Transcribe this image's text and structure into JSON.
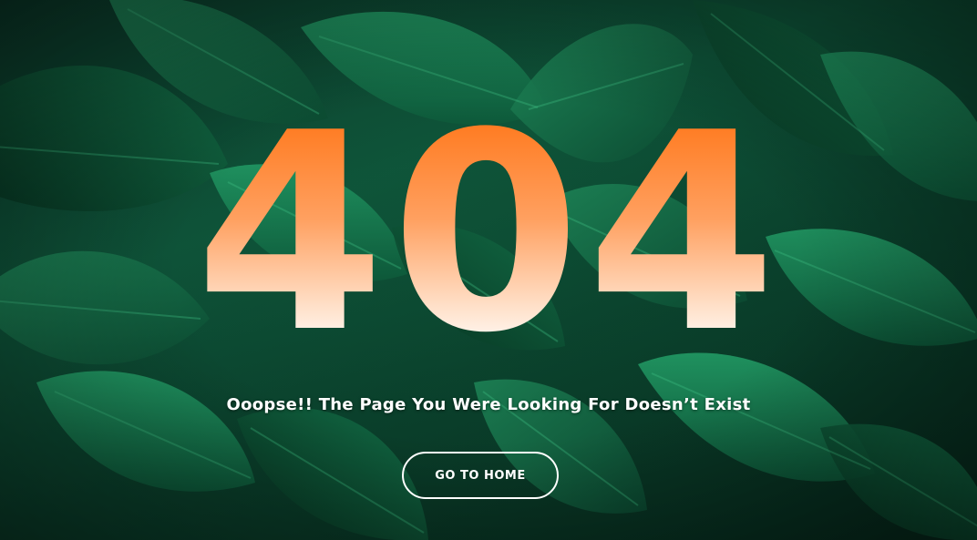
{
  "error": {
    "code": "404",
    "message": "Ooopse!! The Page You Were Looking For Doesn’t Exist"
  },
  "actions": {
    "home_label": "GO TO HOME"
  },
  "colors": {
    "digits_top": "#ff7a1f",
    "digits_bottom": "#ffffff",
    "background": "#0e5238",
    "text": "#ffffff"
  }
}
